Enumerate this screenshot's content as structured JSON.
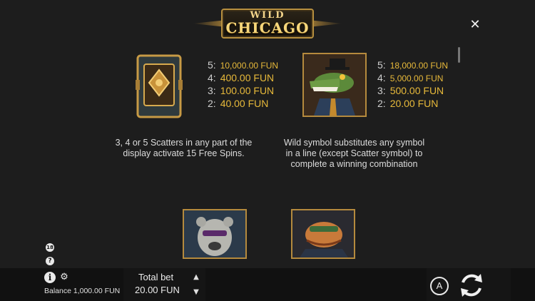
{
  "logo": {
    "line1": "WILD",
    "line2": "CHICAGO"
  },
  "close": {
    "icon": "close-icon",
    "glyph": "✕"
  },
  "scatter": {
    "pays": [
      {
        "count": "5:",
        "value": "10,000.00 FUN"
      },
      {
        "count": "4:",
        "value": "400.00 FUN"
      },
      {
        "count": "3:",
        "value": "100.00 FUN"
      },
      {
        "count": "2:",
        "value": "40.00 FUN"
      }
    ],
    "description": "3, 4 or 5 Scatters in any part of the display activate 15 Free Spins."
  },
  "wild": {
    "pays": [
      {
        "count": "5:",
        "value": "18,000.00 FUN"
      },
      {
        "count": "4:",
        "value": "5,000.00 FUN"
      },
      {
        "count": "3:",
        "value": "500.00 FUN"
      },
      {
        "count": "2:",
        "value": "20.00 FUN"
      }
    ],
    "description": "Wild symbol substitutes any symbol in a line (except Scatter symbol) to complete a winning combination"
  },
  "bottom": {
    "total_bet_label": "Total bet",
    "total_bet_value": "20.00 FUN",
    "balance": "Balance 1,000.00 FUN",
    "auto_label": "A",
    "info_glyph": "i",
    "help_glyph": "?",
    "age_glyph": "18",
    "gear_glyph": "⚙",
    "up_glyph": "▲",
    "down_glyph": "▼"
  },
  "colors": {
    "accent": "#e7b93a",
    "background": "#1d1d1d",
    "bar": "#111111"
  }
}
